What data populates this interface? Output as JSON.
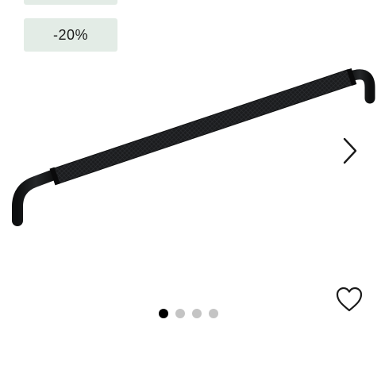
{
  "badges": {
    "top": "",
    "discount": "-20%"
  },
  "badge_color": "#e3ece6",
  "product": {
    "image_icon": "knurled-bar-handle-image"
  },
  "gallery": {
    "next_icon": "chevron-right-icon",
    "dots": [
      {
        "active": true
      },
      {
        "active": false
      },
      {
        "active": false
      },
      {
        "active": false
      }
    ]
  },
  "wishlist_icon": "heart-outline-icon"
}
